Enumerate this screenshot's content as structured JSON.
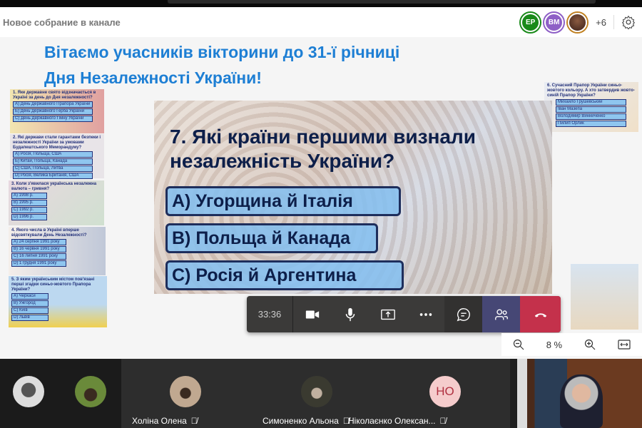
{
  "header": {
    "title": "Новое собрание в канале",
    "participants": [
      {
        "initials": "ЕР",
        "color": "#1a8a1a"
      },
      {
        "initials": "ВМ",
        "color": "#8e5fc6"
      },
      {
        "initials": "",
        "color": "#c08020"
      }
    ],
    "more": "+6"
  },
  "heading": {
    "line1": "Вітаємо учасників вікторини до 31-ї річниці",
    "line2": "Дня Незалежності України!"
  },
  "slide": {
    "question": "7. Які країни першими визнали незалежність України?",
    "answers": [
      "A)  Угорщина й Італія",
      "B) Польща й Канада",
      "C) Росія й Аргентина"
    ]
  },
  "thumbs": [
    {
      "q": "1. Яке державне свято відзначається в Україні за день до Дня незалежності?",
      "opts": [
        "А) День Державного Прапора України",
        "Б) День Державного Герба України",
        "С) День Державного Гімну України"
      ]
    },
    {
      "q": "2. Які держави стали гарантами безпеки і незалежності України за умовами Будапештського Меморандуму?",
      "opts": [
        "А) Росія, Польща, США",
        "Б) Китай, Польща, Канада",
        "С) США, Польща, Литва",
        "D) Росія, Велика Британія, США"
      ]
    },
    {
      "q": "3. Коли з'явилася українська незалежна валюта – гривня?",
      "opts": [
        "A) 1998 р.",
        "B) 1995 р.",
        "C) 1992 р.",
        "D) 1996 р."
      ]
    },
    {
      "q": "4. Якого числа в Україні вперше відсвяткували День Незалежності?",
      "opts": [
        "А) 24 серпня 1991 року",
        "B) 16 червня 1991 року",
        "C) 16 липня 1991 року",
        "D) 1 грудня 1991 року"
      ]
    },
    {
      "q": "5. З яким українським містом пов'язані перші згадки синьо-жовтого Прапора України?",
      "opts": [
        "A) Черкаси",
        "B) Ужгород",
        "C) Київ",
        "D) Львів"
      ]
    },
    {
      "q": "6. Сучасний Прапор України синьо-жовтого кольору. А хто затвердив жовто-синій Прапор України?",
      "opts": [
        "Михайло Грушевський",
        "Іван Мазепа",
        "Володимир Винниченко",
        "Пилип Орлик"
      ]
    }
  ],
  "controls": {
    "timer": "33:36"
  },
  "zoom": {
    "level": "8 %"
  },
  "participants": [
    {
      "name": "Холіна Олена"
    },
    {
      "name": "Симоненко Альона"
    },
    {
      "name": "Ніколаєнко Олексан...",
      "initials": "НО"
    }
  ],
  "colors": {
    "hangup": "#c4314b",
    "active": "#464775",
    "heading": "#1e7fd4"
  }
}
